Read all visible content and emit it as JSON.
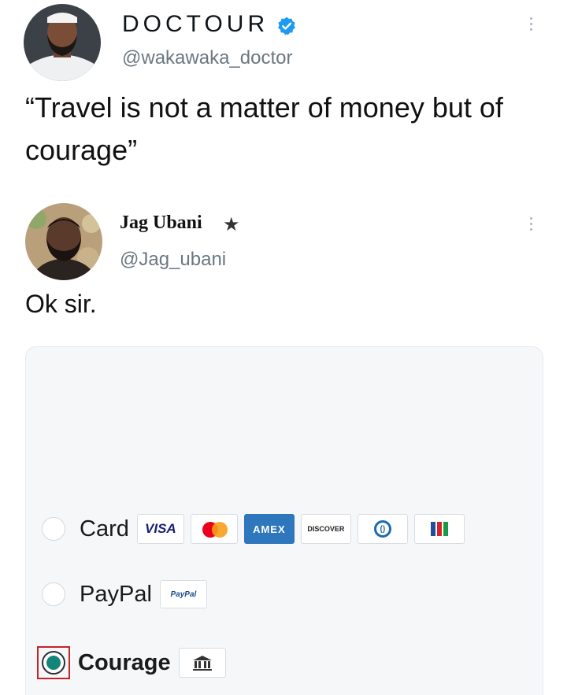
{
  "tweet1": {
    "display_name": "DOCTOUR",
    "handle": "@wakawaka_doctor",
    "verified_icon": "verified-badge-icon",
    "text": "“Travel is not a matter of money but of courage”"
  },
  "tweet2": {
    "display_name": "Jag Ubani",
    "star": "★",
    "handle": "@Jag_ubani",
    "text": "Ok sir."
  },
  "payment": {
    "options": [
      {
        "label": "Card",
        "selected": false
      },
      {
        "label": "PayPal",
        "selected": false
      },
      {
        "label": "Courage",
        "selected": true
      }
    ],
    "card_logos": {
      "visa": "VISA",
      "amex": "AMEX",
      "discover": "DISCOVER"
    },
    "paypal_logo": "PayPal",
    "colors": {
      "selected_radio": "#14857a",
      "highlight_border": "#c8232c",
      "card_background": "#f5f7f9",
      "verified_blue": "#1d9bf0"
    }
  }
}
